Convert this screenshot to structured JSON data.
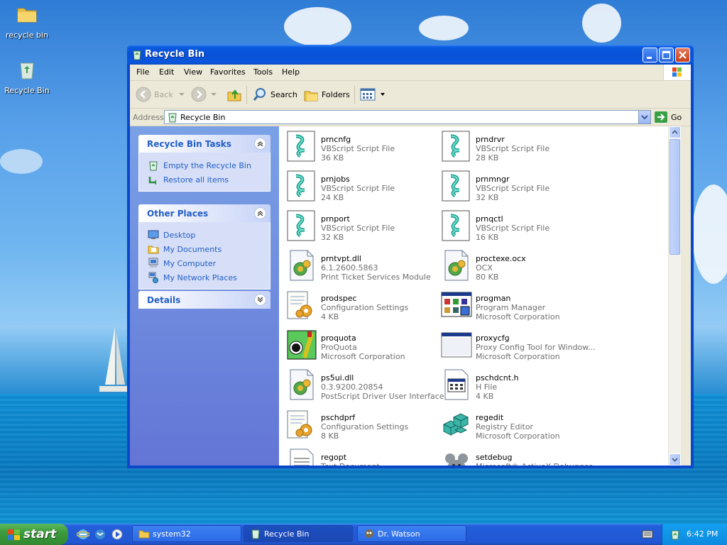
{
  "desktop": {
    "icons": [
      {
        "label": "recycle bin",
        "icon": "folder-icon"
      },
      {
        "label": "Recycle Bin",
        "icon": "recycle-bin-icon"
      }
    ]
  },
  "window": {
    "title": "Recycle Bin",
    "menu": [
      "File",
      "Edit",
      "View",
      "Favorites",
      "Tools",
      "Help"
    ],
    "toolbar": {
      "back": "Back",
      "search": "Search",
      "folders": "Folders"
    },
    "address": {
      "label": "Address",
      "value": "Recycle Bin",
      "go": "Go"
    },
    "tasks_panel": {
      "title": "Recycle Bin Tasks",
      "items": [
        "Empty the Recycle Bin",
        "Restore all items"
      ]
    },
    "places_panel": {
      "title": "Other Places",
      "items": [
        "Desktop",
        "My Documents",
        "My Computer",
        "My Network Places"
      ]
    },
    "details_panel": {
      "title": "Details"
    },
    "files": [
      {
        "name": "prncnfg",
        "l2": "VBScript Script File",
        "l3": "36 KB",
        "icon": "vbscript-icon"
      },
      {
        "name": "prndrvr",
        "l2": "VBScript Script File",
        "l3": "28 KB",
        "icon": "vbscript-icon"
      },
      {
        "name": "prnjobs",
        "l2": "VBScript Script File",
        "l3": "24 KB",
        "icon": "vbscript-icon"
      },
      {
        "name": "prnmngr",
        "l2": "VBScript Script File",
        "l3": "32 KB",
        "icon": "vbscript-icon"
      },
      {
        "name": "prnport",
        "l2": "VBScript Script File",
        "l3": "32 KB",
        "icon": "vbscript-icon"
      },
      {
        "name": "prnqctl",
        "l2": "VBScript Script File",
        "l3": "16 KB",
        "icon": "vbscript-icon"
      },
      {
        "name": "prntvpt.dll",
        "l2": "6.1.2600.5863",
        "l3": "Print Ticket Services Module",
        "icon": "dll-icon"
      },
      {
        "name": "proctexe.ocx",
        "l2": "OCX",
        "l3": "80 KB",
        "icon": "dll-icon"
      },
      {
        "name": "prodspec",
        "l2": "Configuration Settings",
        "l3": "4 KB",
        "icon": "config-icon"
      },
      {
        "name": "progman",
        "l2": "Program Manager",
        "l3": "Microsoft Corporation",
        "icon": "progman-icon"
      },
      {
        "name": "proquota",
        "l2": "ProQuota",
        "l3": "Microsoft Corporation",
        "icon": "proquota-icon"
      },
      {
        "name": "proxycfg",
        "l2": "Proxy Config Tool for Window...",
        "l3": "Microsoft Corporation",
        "icon": "window-app-icon"
      },
      {
        "name": "ps5ui.dll",
        "l2": "0.3.9200.20854",
        "l3": "PostScript Driver User Interface",
        "icon": "dll-icon"
      },
      {
        "name": "pschdcnt.h",
        "l2": "H File",
        "l3": "4 KB",
        "icon": "h-file-icon"
      },
      {
        "name": "pschdprf",
        "l2": "Configuration Settings",
        "l3": "8 KB",
        "icon": "config-icon"
      },
      {
        "name": "regedit",
        "l2": "Registry Editor",
        "l3": "Microsoft Corporation",
        "icon": "regedit-icon"
      },
      {
        "name": "regopt",
        "l2": "Text Document",
        "l3": "",
        "icon": "text-doc-icon"
      },
      {
        "name": "setdebug",
        "l2": "Microsoft® ActiveX Debugger ...",
        "l3": "",
        "icon": "debugger-icon"
      }
    ]
  },
  "taskbar": {
    "start": "start",
    "buttons": [
      {
        "label": "system32",
        "icon": "folder-icon"
      },
      {
        "label": "Recycle Bin",
        "icon": "recycle-bin-icon",
        "active": true
      },
      {
        "label": "Dr. Watson",
        "icon": "dr-watson-icon"
      }
    ],
    "clock": "6:42 PM"
  }
}
